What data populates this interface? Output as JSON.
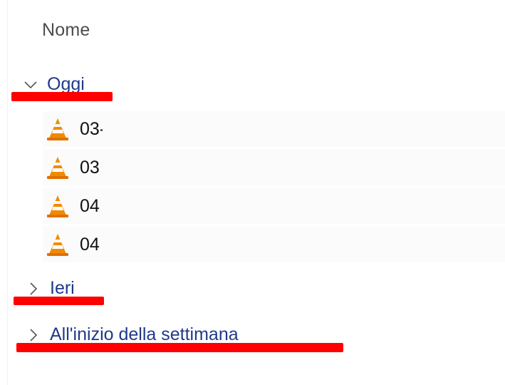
{
  "header": {
    "name_column": "Nome"
  },
  "groups": {
    "today": {
      "label": "Oggi",
      "expanded": true
    },
    "yesterday": {
      "label": "Ieri",
      "expanded": false
    },
    "week": {
      "label": "All'inizio della settimana",
      "expanded": false
    }
  },
  "files": [
    {
      "name": "03-",
      "icon": "vlc-cone-icon"
    },
    {
      "name": "03",
      "icon": "vlc-cone-icon"
    },
    {
      "name": "04",
      "icon": "vlc-cone-icon"
    },
    {
      "name": "04",
      "icon": "vlc-cone-icon"
    }
  ],
  "colors": {
    "group_label": "#1e3a8a",
    "redaction": "#ff0000",
    "cone_orange": "#f28a00"
  }
}
